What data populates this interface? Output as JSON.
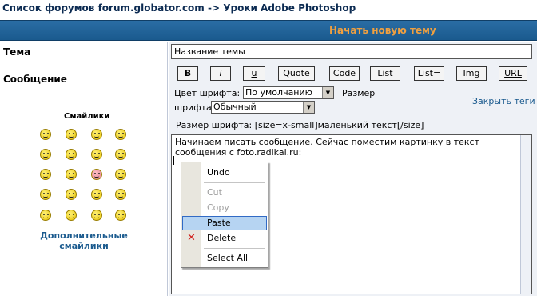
{
  "breadcrumb": {
    "forum_list": "Список форумов forum.globator.com",
    "separator": "->",
    "current": "Уроки Adobe Photoshop"
  },
  "header": {
    "title": "Начать новую тему"
  },
  "form": {
    "subject_label": "Тема",
    "subject_value": "Название темы",
    "message_label": "Сообщение",
    "toolbar": [
      "B",
      "i",
      "u",
      "Quote",
      "Code",
      "List",
      "List=",
      "Img",
      "URL"
    ],
    "font_color_label": "Цвет шрифта:",
    "font_color_value": "По умолчанию",
    "font_size_label_1": "Размер",
    "font_size_label_2": "шрифта:",
    "font_size_value": "Обычный",
    "close_tags": "Закрыть теги",
    "size_hint": "Размер шрифта: [size=x-small]маленький текст[/size]",
    "message_line_1": "Начинаем писать сообщение. Сейчас поместим картинку в текст",
    "message_line_2": "сообщения с foto.radikal.ru:"
  },
  "smilies": {
    "title": "Смайлики",
    "more_line_1": "Дополнительные",
    "more_line_2": "смайлики",
    "icons": [
      "smile-icon",
      "biggrin-icon",
      "sad-icon",
      "surprised-icon",
      "eek-icon",
      "confused-icon",
      "cool-icon",
      "lol-icon",
      "mad-icon",
      "razz-icon",
      "redface-icon",
      "cry-icon",
      "evil-icon",
      "twisted-icon",
      "rolleyes-icon",
      "wink-icon",
      "exclaim-icon",
      "question-icon",
      "idea-icon",
      "arrow-icon"
    ]
  },
  "context_menu": {
    "undo": "Undo",
    "cut": "Cut",
    "copy": "Copy",
    "paste": "Paste",
    "delete": "Delete",
    "select_all": "Select All"
  }
}
